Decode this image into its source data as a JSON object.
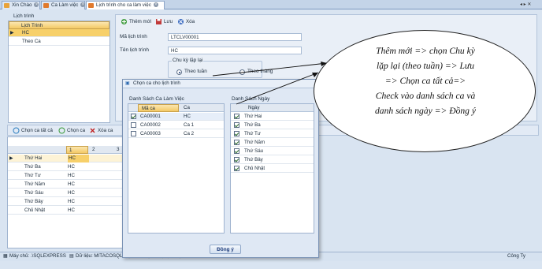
{
  "tabs": [
    {
      "label": "Xin Chào",
      "icon": "home-icon",
      "color": "#e8a23a"
    },
    {
      "label": "Ca Làm việc",
      "icon": "calendar-icon",
      "color": "#e07a2e"
    },
    {
      "label": "Lịch trình cho ca làm việc",
      "icon": "calendar-icon",
      "color": "#e07a2e"
    }
  ],
  "window_controls": "◂ ▸ ✕",
  "left_panel": {
    "group_title": "Lịch trình",
    "column": "Lịch Trình",
    "rows": [
      "HC",
      "Theo Ca"
    ]
  },
  "toolbar": {
    "add": "Thêm mới",
    "save": "Lưu",
    "delete": "Xóa"
  },
  "form": {
    "code_label": "Mã lịch trình",
    "code_value": "LTCLV00001",
    "name_label": "Tên lịch trình",
    "name_value": "HC",
    "cycle_label": "Chu kỳ lặp lại",
    "opt_week": "Theo tuần",
    "opt_month": "Theo tháng"
  },
  "lower_toolbar": {
    "select_all": "Chọn ca tất cả",
    "select_shift": "Chọn ca",
    "delete_shift": "Xóa ca",
    "delete_all": "Xóa"
  },
  "schedule_grid": {
    "columns": [
      "1",
      "2",
      "3"
    ],
    "rows": [
      {
        "day": "Thứ Hai",
        "c1": "HC"
      },
      {
        "day": "Thứ Ba",
        "c1": "HC"
      },
      {
        "day": "Thứ Tư",
        "c1": "HC"
      },
      {
        "day": "Thứ Năm",
        "c1": "HC"
      },
      {
        "day": "Thứ Sáu",
        "c1": "HC"
      },
      {
        "day": "Thứ Bảy",
        "c1": "HC"
      },
      {
        "day": "Chủ Nhật",
        "c1": "HC"
      }
    ]
  },
  "dialog": {
    "title": "Chọn ca cho lịch trình",
    "shifts_title": "Danh Sách Ca Làm Việc",
    "shift_headers": [
      "Mã ca",
      "Ca"
    ],
    "shifts": [
      {
        "code": "CA00001",
        "name": "HC",
        "checked": true
      },
      {
        "code": "CA00002",
        "name": "Ca 1",
        "checked": false
      },
      {
        "code": "CA00003",
        "name": "Ca 2",
        "checked": false
      }
    ],
    "days_title": "Danh Sách Ngày",
    "days_header": "Ngày",
    "days": [
      "Thứ Hai",
      "Thứ Ba",
      "Thứ Tư",
      "Thứ Năm",
      "Thứ Sáu",
      "Thứ Bảy",
      "Chủ Nhật"
    ],
    "ok": "Đồng ý"
  },
  "status": {
    "server": "Máy chủ: .\\SQLEXPRESS",
    "db": "Dữ liệu: MITACOSQL",
    "user": "Người dùng: Nhập quản lý",
    "company": "Công Ty"
  },
  "callout_lines": [
    "Thêm mới => chọn Chu kỳ",
    "lặp lại (theo tuần) => Lưu",
    "=> Chọn ca tất cả=>",
    "Check vào danh sách ca và",
    "danh sách ngày => Đồng ý"
  ],
  "colors": {
    "accent": "#f4c965",
    "header_blue": "#d9e4f1"
  }
}
